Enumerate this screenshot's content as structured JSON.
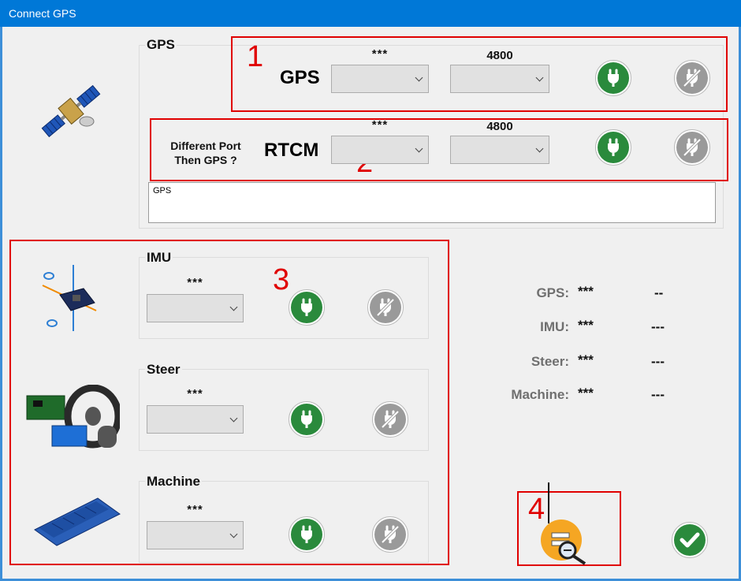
{
  "window": {
    "title": "Connect GPS"
  },
  "gps_group": {
    "title": "GPS",
    "gps_row": {
      "label": "GPS",
      "port_value": "***",
      "baud_value": "4800",
      "connect_icon": "plug-connect-icon",
      "disconnect_icon": "plug-disconnect-icon"
    },
    "rtcm_row": {
      "label": "RTCM",
      "different_port_line1": "Different Port",
      "different_port_line2": "Then GPS ?",
      "port_value": "***",
      "baud_value": "4800"
    },
    "log_text": "GPS"
  },
  "imu_group": {
    "title": "IMU",
    "port_value": "***"
  },
  "steer_group": {
    "title": "Steer",
    "port_value": "***"
  },
  "machine_group": {
    "title": "Machine",
    "port_value": "***"
  },
  "status": {
    "gps_label": "GPS:",
    "gps_port": "***",
    "gps_state": "--",
    "imu_label": "IMU:",
    "imu_port": "***",
    "imu_state": "---",
    "steer_label": "Steer:",
    "steer_port": "***",
    "steer_state": "---",
    "machine_label": "Machine:",
    "machine_port": "***",
    "machine_state": "---"
  },
  "annotations": {
    "n1": "1",
    "n2": "2",
    "n3": "3",
    "n4": "4"
  },
  "colors": {
    "titlebar": "#0078d7",
    "connect_green": "#2a8a3c",
    "disconnect_gray": "#9a9a9a",
    "annotation_red": "#e00000"
  }
}
